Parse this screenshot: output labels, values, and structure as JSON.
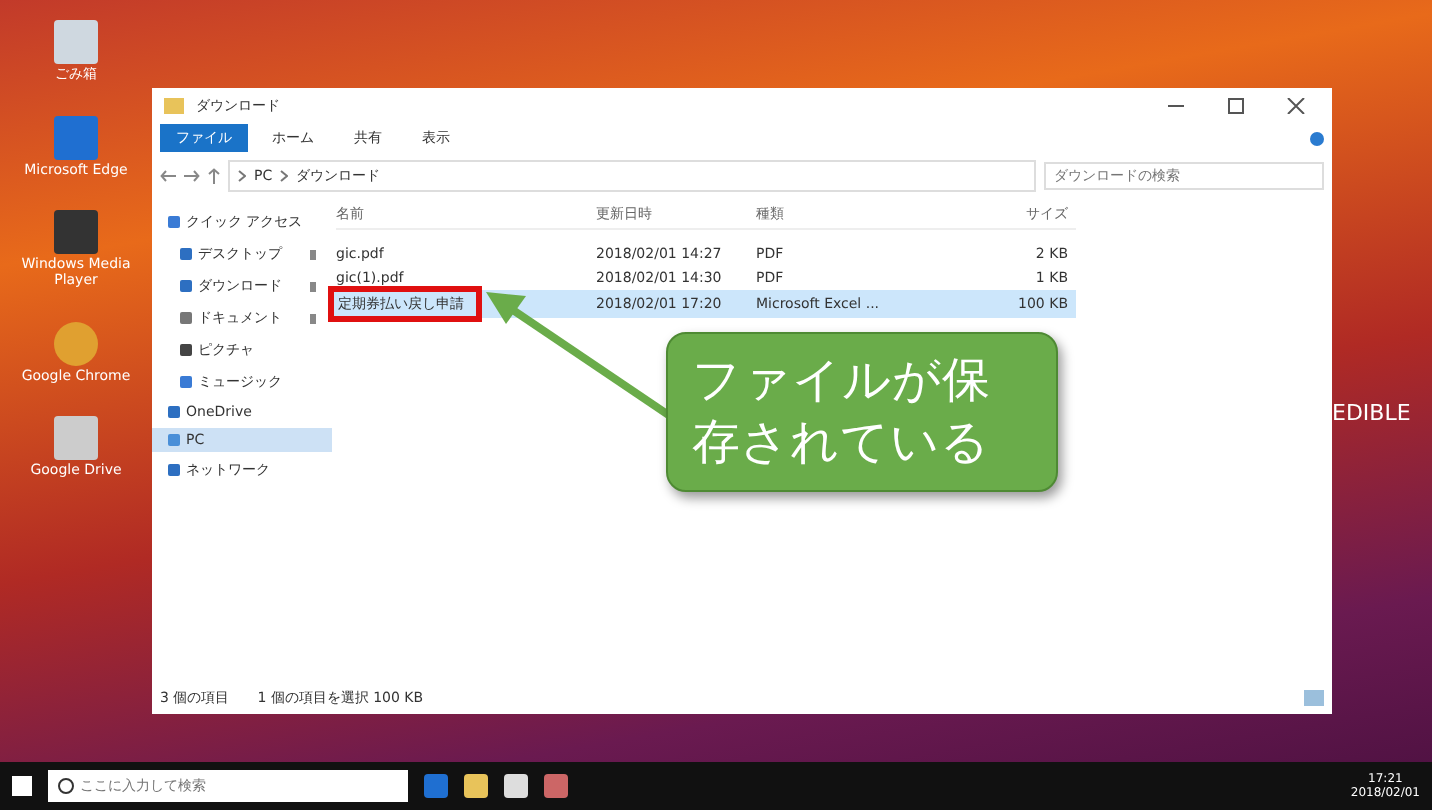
{
  "desktop_icons": [
    {
      "label": "ごみ箱",
      "kind": "bin"
    },
    {
      "label": "Microsoft Edge",
      "kind": "edge"
    },
    {
      "label": "Windows Media Player",
      "kind": "media"
    },
    {
      "label": "Google Chrome",
      "kind": "chrome"
    },
    {
      "label": "Google Drive",
      "kind": "drive"
    }
  ],
  "wallpaper_text": "EDIBLE",
  "window": {
    "title": "ダウンロード",
    "ribbon_tabs": [
      {
        "label": "ファイル",
        "selected": true
      },
      {
        "label": "ホーム",
        "selected": false
      },
      {
        "label": "共有",
        "selected": false
      },
      {
        "label": "表示",
        "selected": false
      }
    ],
    "address": [
      "PC",
      "ダウンロード"
    ],
    "search": {
      "placeholder": "ダウンロードの検索"
    },
    "nav": [
      {
        "label": "クイック アクセス",
        "kind": "star",
        "selected": false,
        "children": [
          {
            "label": "デスクトップ",
            "kind": "desktop",
            "pinned": true,
            "selected": false
          },
          {
            "label": "ダウンロード",
            "kind": "download",
            "pinned": true,
            "selected": false
          },
          {
            "label": "ドキュメント",
            "kind": "docs",
            "pinned": true,
            "selected": false
          },
          {
            "label": "ピクチャ",
            "kind": "pics",
            "pinned": false,
            "selected": false
          },
          {
            "label": "ミュージック",
            "kind": "music",
            "pinned": false,
            "selected": false
          }
        ]
      },
      {
        "label": "OneDrive",
        "kind": "cloud",
        "selected": false
      },
      {
        "label": "PC",
        "kind": "pc",
        "selected": true
      },
      {
        "label": "ネットワーク",
        "kind": "net",
        "selected": false
      }
    ],
    "columns": [
      "名前",
      "更新日時",
      "種類",
      "サイズ"
    ],
    "rows": [
      {
        "cells": [
          "gic.pdf",
          "2018/02/01 14:27",
          "PDF",
          "2 KB"
        ],
        "selected": false,
        "highlighted": false
      },
      {
        "cells": [
          "gic(1).pdf",
          "2018/02/01 14:30",
          "PDF",
          "1 KB"
        ],
        "selected": false,
        "highlighted": false
      },
      {
        "cells": [
          "定期券払い戻し申請",
          "2018/02/01 17:20",
          "Microsoft Excel ...",
          "100 KB"
        ],
        "selected": true,
        "highlighted": true
      }
    ],
    "status": [
      "3 個の項目",
      "1 個の項目を選択 100 KB"
    ]
  },
  "callout": {
    "text": "ファイルが保存されている"
  },
  "taskbar": {
    "search_placeholder": "ここに入力して検索",
    "time": "17:21",
    "date": "2018/02/01"
  }
}
